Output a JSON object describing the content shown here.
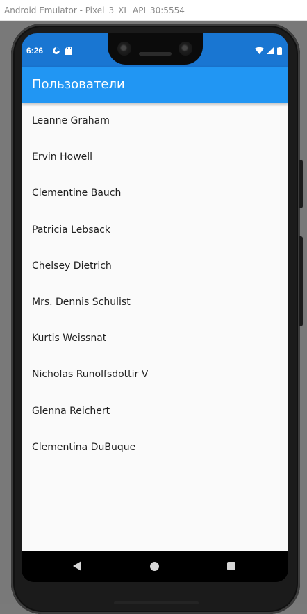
{
  "window": {
    "title": "Android Emulator - Pixel_3_XL_API_30:5554"
  },
  "status_bar": {
    "time": "6:26",
    "icons": [
      "data-saver-icon",
      "sd-card-icon",
      "wifi-icon",
      "cell-signal-icon",
      "battery-icon"
    ],
    "color": "#1976d2"
  },
  "app_bar": {
    "title": "Пользователи",
    "color": "#2196f3"
  },
  "users": [
    {
      "name": "Leanne Graham"
    },
    {
      "name": "Ervin Howell"
    },
    {
      "name": "Clementine Bauch"
    },
    {
      "name": "Patricia Lebsack"
    },
    {
      "name": "Chelsey Dietrich"
    },
    {
      "name": "Mrs. Dennis Schulist"
    },
    {
      "name": "Kurtis Weissnat"
    },
    {
      "name": "Nicholas Runolfsdottir V"
    },
    {
      "name": "Glenna Reichert"
    },
    {
      "name": "Clementina DuBuque"
    }
  ],
  "nav_bar": {
    "buttons": [
      "back-icon",
      "home-icon",
      "recents-icon"
    ]
  }
}
